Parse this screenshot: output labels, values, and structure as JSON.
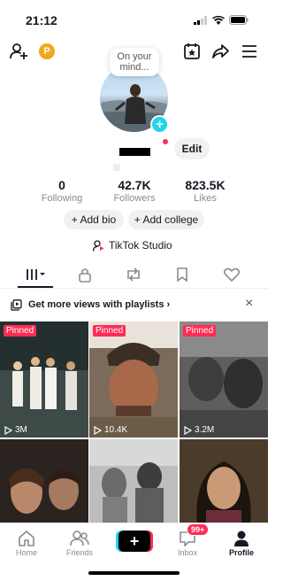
{
  "status_bar": {
    "time": "21:12"
  },
  "topbar": {
    "coin_label": "P"
  },
  "profile": {
    "bubble_text": "On your mind...",
    "avatar_add": "+",
    "edit_label": "Edit"
  },
  "stats": [
    {
      "value": "0",
      "label": "Following"
    },
    {
      "value": "42.7K",
      "label": "Followers"
    },
    {
      "value": "823.5K",
      "label": "Likes"
    }
  ],
  "actions": {
    "add_bio": "+ Add bio",
    "add_college": "+ Add college"
  },
  "studio": {
    "label": "TikTok Studio"
  },
  "promo": {
    "text": "Get more views with playlists ›",
    "close": "×"
  },
  "videos": [
    {
      "pinned": "Pinned",
      "views": "3M"
    },
    {
      "pinned": "Pinned",
      "views": "10.4K"
    },
    {
      "pinned": "Pinned",
      "views": "3.2M"
    }
  ],
  "bottom_nav": {
    "home": "Home",
    "friends": "Friends",
    "create": "+",
    "inbox": "Inbox",
    "inbox_badge": "99+",
    "profile": "Profile"
  },
  "colors": {
    "accent": "#fe2c55",
    "cyan": "#20d5ec",
    "coin": "#f0a81c"
  }
}
